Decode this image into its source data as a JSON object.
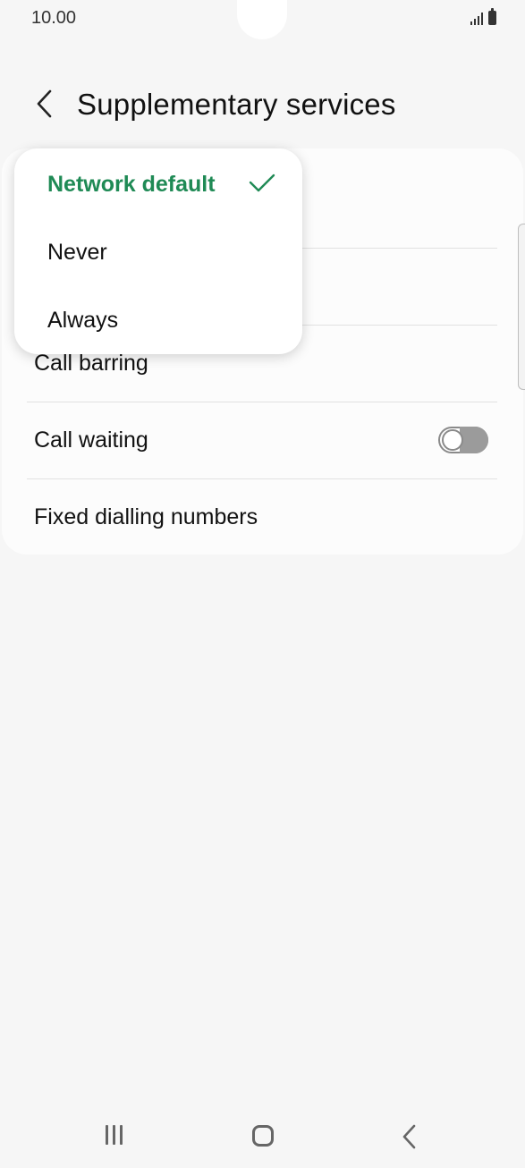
{
  "status_bar": {
    "time": "10.00",
    "icons": [
      "signal-icon",
      "battery-icon"
    ]
  },
  "header": {
    "back_icon": "chevron-left-icon",
    "title": "Supplementary services"
  },
  "settings": {
    "items": [
      {
        "label": ""
      },
      {
        "label": ""
      },
      {
        "label": "Call barring"
      },
      {
        "label": "Call waiting",
        "toggle_on": false
      },
      {
        "label": "Fixed dialling numbers"
      }
    ]
  },
  "dropdown": {
    "options": [
      {
        "label": "Network default",
        "selected": true
      },
      {
        "label": "Never",
        "selected": false
      },
      {
        "label": "Always",
        "selected": false
      }
    ],
    "check_icon": "checkmark-icon",
    "accent_color": "#1f8a55"
  },
  "nav_bar": {
    "icons": [
      "recents-icon",
      "home-icon",
      "back-icon"
    ]
  }
}
